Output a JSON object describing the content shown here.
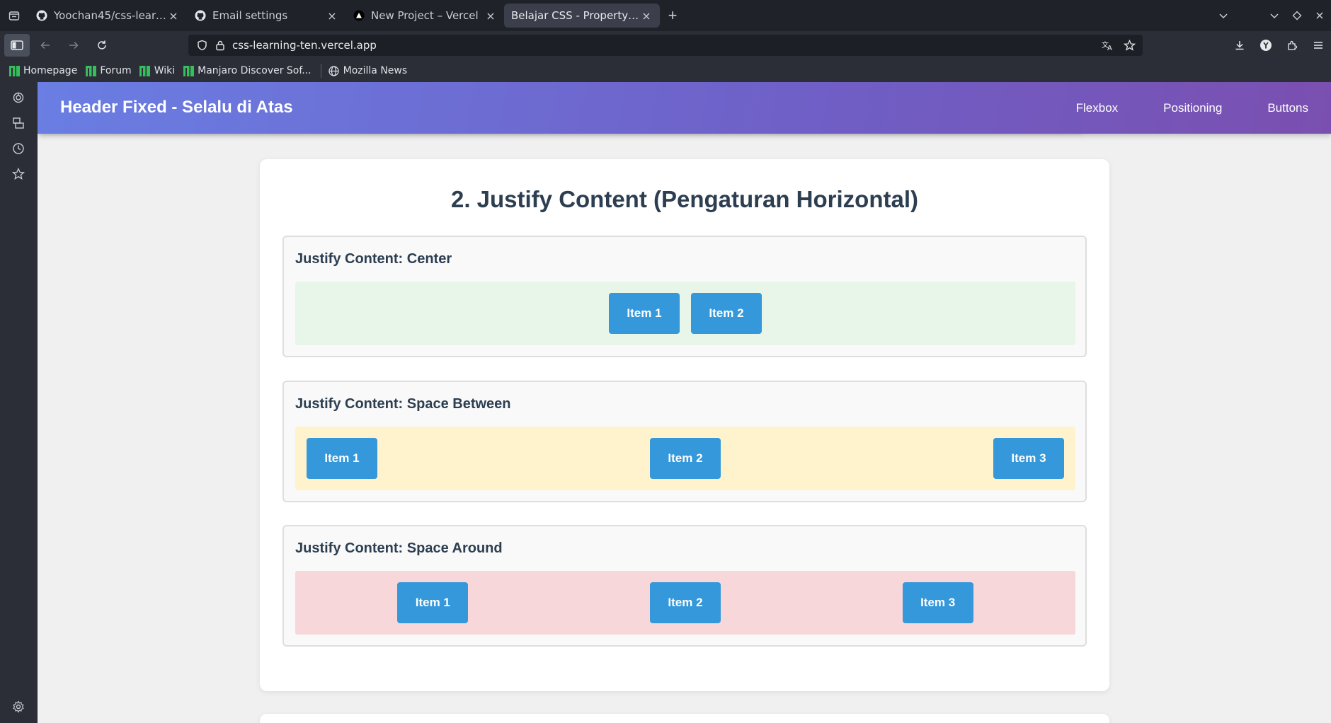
{
  "browser": {
    "tabs": [
      {
        "title": "Yoochan45/css-learning",
        "icon": "github-icon",
        "active": false
      },
      {
        "title": "Email settings",
        "icon": "github-icon",
        "active": false
      },
      {
        "title": "New Project – Vercel",
        "icon": "vercel-icon",
        "active": false
      },
      {
        "title": "Belajar CSS - Property Penting",
        "icon": "none",
        "active": true
      }
    ],
    "new_tab_label": "+",
    "close_label": "×",
    "url": "css-learning-ten.vercel.app",
    "bookmarks": [
      {
        "label": "Homepage",
        "icon": "manjaro-icon"
      },
      {
        "label": "Forum",
        "icon": "manjaro-icon"
      },
      {
        "label": "Wiki",
        "icon": "manjaro-icon"
      },
      {
        "label": "Manjaro Discover Sof...",
        "icon": "manjaro-icon"
      },
      {
        "label": "Mozilla News",
        "icon": "globe-icon"
      }
    ],
    "sidebar_icons": [
      "ai-chatbot-icon",
      "synced-tabs-icon",
      "history-icon",
      "bookmarks-star-icon",
      "settings-gear-icon"
    ]
  },
  "page": {
    "header_title": "Header Fixed - Selalu di Atas",
    "nav": [
      "Flexbox",
      "Positioning",
      "Buttons"
    ],
    "section_title": "2. Justify Content (Pengaturan Horizontal)",
    "demos": [
      {
        "title": "Justify Content: Center",
        "items": [
          "Item 1",
          "Item 2"
        ],
        "bg": "#e8f5e9"
      },
      {
        "title": "Justify Content: Space Between",
        "items": [
          "Item 1",
          "Item 2",
          "Item 3"
        ],
        "bg": "#fff3cd"
      },
      {
        "title": "Justify Content: Space Around",
        "items": [
          "Item 1",
          "Item 2",
          "Item 3"
        ],
        "bg": "#f8d7da"
      }
    ]
  },
  "colors": {
    "header_gradient_start": "#6a7ee3",
    "header_gradient_end": "#7a4fb0",
    "item_blue": "#3498db",
    "title_text": "#2c3e50"
  }
}
